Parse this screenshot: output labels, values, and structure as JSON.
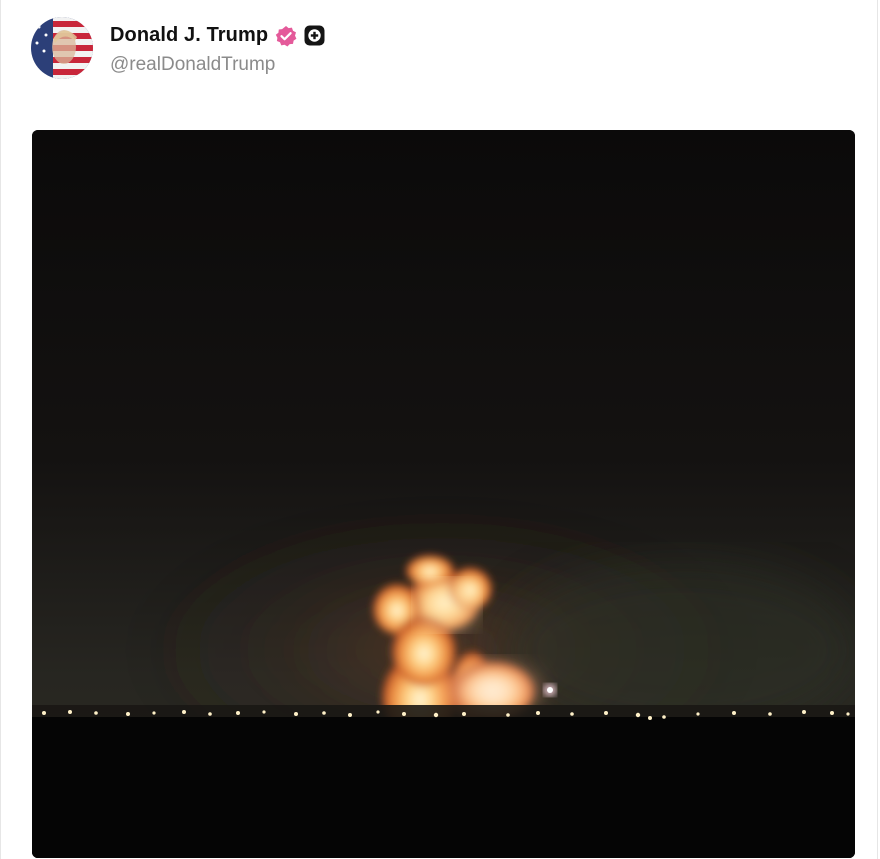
{
  "post": {
    "author": {
      "display_name": "Donald J. Trump",
      "handle": "@realDonaldTrump",
      "verified_icon": "verified-badge-icon",
      "extra_badge_icon": "plus-badge-icon"
    },
    "media": {
      "type": "video-still",
      "subject": "nighttime explosion fireball over a distant horizon"
    }
  },
  "colors": {
    "verified_badge": "#e45a9a",
    "name_text": "#111111",
    "handle_text": "#8b8b8b",
    "media_background": "#0b0a0a"
  }
}
